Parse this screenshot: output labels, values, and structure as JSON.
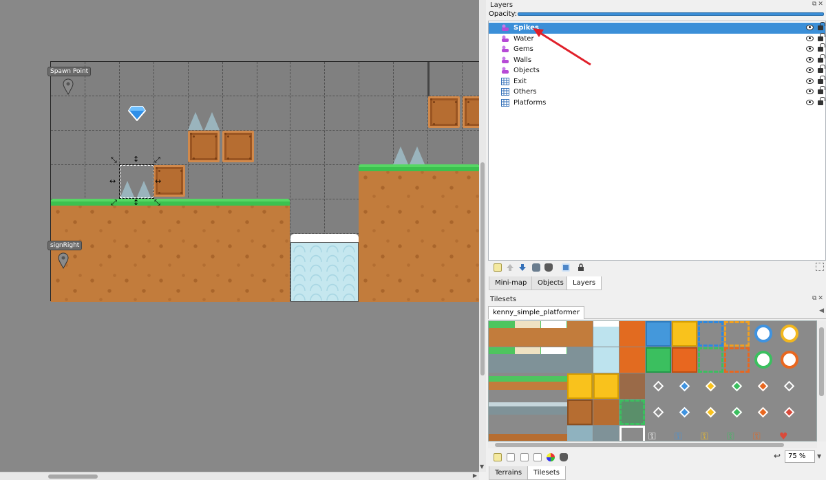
{
  "map": {
    "objects": [
      {
        "id": "spawn",
        "label": "Spawn Point"
      },
      {
        "id": "sign",
        "label": "signRight"
      }
    ]
  },
  "layers_panel": {
    "title": "Layers",
    "opacity_label": "Opacity:",
    "opacity_value": 1.0,
    "layers": [
      {
        "name": "Spikes",
        "type": "object",
        "selected": true
      },
      {
        "name": "Water",
        "type": "object",
        "selected": false
      },
      {
        "name": "Gems",
        "type": "object",
        "selected": false
      },
      {
        "name": "Walls",
        "type": "object",
        "selected": false
      },
      {
        "name": "Objects",
        "type": "object",
        "selected": false
      },
      {
        "name": "Exit",
        "type": "tile",
        "selected": false
      },
      {
        "name": "Others",
        "type": "tile",
        "selected": false
      },
      {
        "name": "Platforms",
        "type": "tile",
        "selected": false
      }
    ],
    "tabs": [
      "Mini-map",
      "Objects",
      "Layers"
    ],
    "active_tab": "Layers"
  },
  "tilesets_panel": {
    "title": "Tilesets",
    "tileset_tab": "kenny_simple_platformer",
    "zoom": "75 %",
    "bottom_tabs": [
      "Terrains",
      "Tilesets"
    ],
    "active_tab": "Tilesets"
  },
  "colors": {
    "selection": "#3b8fd8",
    "annotation_arrow": "#e0202a",
    "object_layer_icon": "#b64ad6",
    "tile_layer_icon": "#3470b8"
  }
}
